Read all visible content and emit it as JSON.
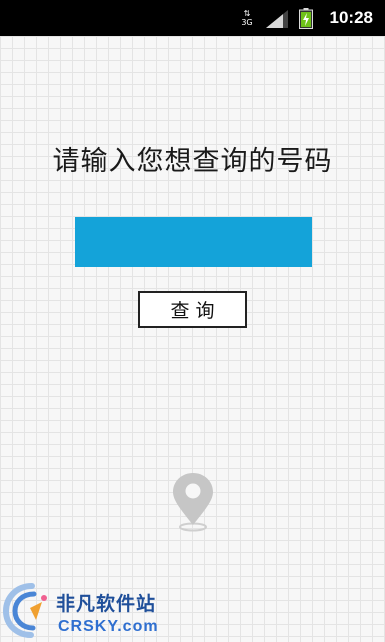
{
  "status_bar": {
    "network_type": "3G",
    "time": "10:28"
  },
  "main": {
    "heading": "请输入您想查询的号码",
    "phone_input": {
      "value": "",
      "placeholder": ""
    },
    "query_button": "查询",
    "pin_icon": "map-pin-icon"
  },
  "watermark": {
    "title": "非凡软件站",
    "site": "CRSKY.com"
  },
  "colors": {
    "input_fill": "#14a3d9",
    "status_bar": "#000000",
    "battery": "#6fc21a"
  }
}
